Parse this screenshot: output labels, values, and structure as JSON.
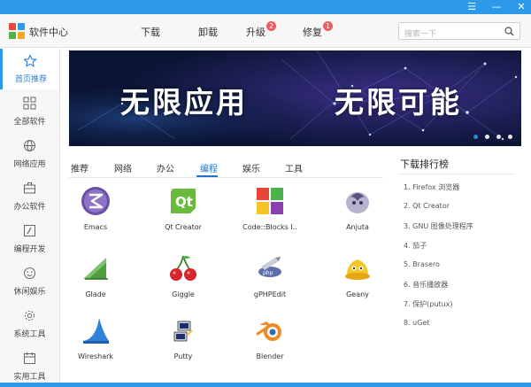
{
  "app": {
    "title": "软件中心"
  },
  "window_controls": {
    "menu": "☰",
    "minimize": "—",
    "close": "✕"
  },
  "nav": {
    "items": [
      {
        "label": "下载",
        "badge": ""
      },
      {
        "label": "卸载",
        "badge": ""
      },
      {
        "label": "升级",
        "badge": "2"
      },
      {
        "label": "修复",
        "badge": "1"
      }
    ]
  },
  "search": {
    "placeholder": "搜索一下"
  },
  "sidebar": {
    "items": [
      {
        "label": "首页推荐",
        "icon": "star-icon",
        "active": true
      },
      {
        "label": "全部软件",
        "icon": "grid-icon"
      },
      {
        "label": "网络应用",
        "icon": "globe-icon"
      },
      {
        "label": "办公软件",
        "icon": "briefcase-icon"
      },
      {
        "label": "编程开发",
        "icon": "code-icon"
      },
      {
        "label": "休闲娱乐",
        "icon": "smile-icon"
      },
      {
        "label": "系统工具",
        "icon": "gear-icon"
      },
      {
        "label": "实用工具",
        "icon": "calendar-icon"
      }
    ]
  },
  "banner": {
    "left_text": "无限应用",
    "right_text": "无限可能",
    "slides": 4,
    "active_slide": 1
  },
  "tabs": {
    "items": [
      "推荐",
      "网络",
      "办公",
      "编程",
      "娱乐",
      "工具"
    ],
    "active": "编程"
  },
  "apps": [
    {
      "name": "Emacs",
      "icon": "emacs-icon"
    },
    {
      "name": "Qt Creator",
      "icon": "qt-creator-icon"
    },
    {
      "name": "Code::Blocks I..",
      "icon": "codeblocks-icon"
    },
    {
      "name": "Anjuta",
      "icon": "anjuta-icon"
    },
    {
      "name": "Glade",
      "icon": "glade-icon"
    },
    {
      "name": "Giggle",
      "icon": "giggle-icon"
    },
    {
      "name": "gPHPEdit",
      "icon": "gphpedit-icon"
    },
    {
      "name": "Geany",
      "icon": "geany-icon"
    },
    {
      "name": "Wireshark",
      "icon": "wireshark-icon"
    },
    {
      "name": "Putty",
      "icon": "putty-icon"
    },
    {
      "name": "Blender",
      "icon": "blender-icon"
    }
  ],
  "ranking": {
    "title": "下载排行榜",
    "items": [
      "1. Firefox 浏览器",
      "2. Qt Creator",
      "3. GNU 图像处理程序",
      "4. 茄子",
      "5. Brasero",
      "6. 音乐播放器",
      "7. 保护(putux)",
      "8. uGet"
    ]
  },
  "colors": {
    "accent": "#2c9ae8",
    "active_tab": "#1f76c9",
    "badge": "#ef5c5c"
  }
}
